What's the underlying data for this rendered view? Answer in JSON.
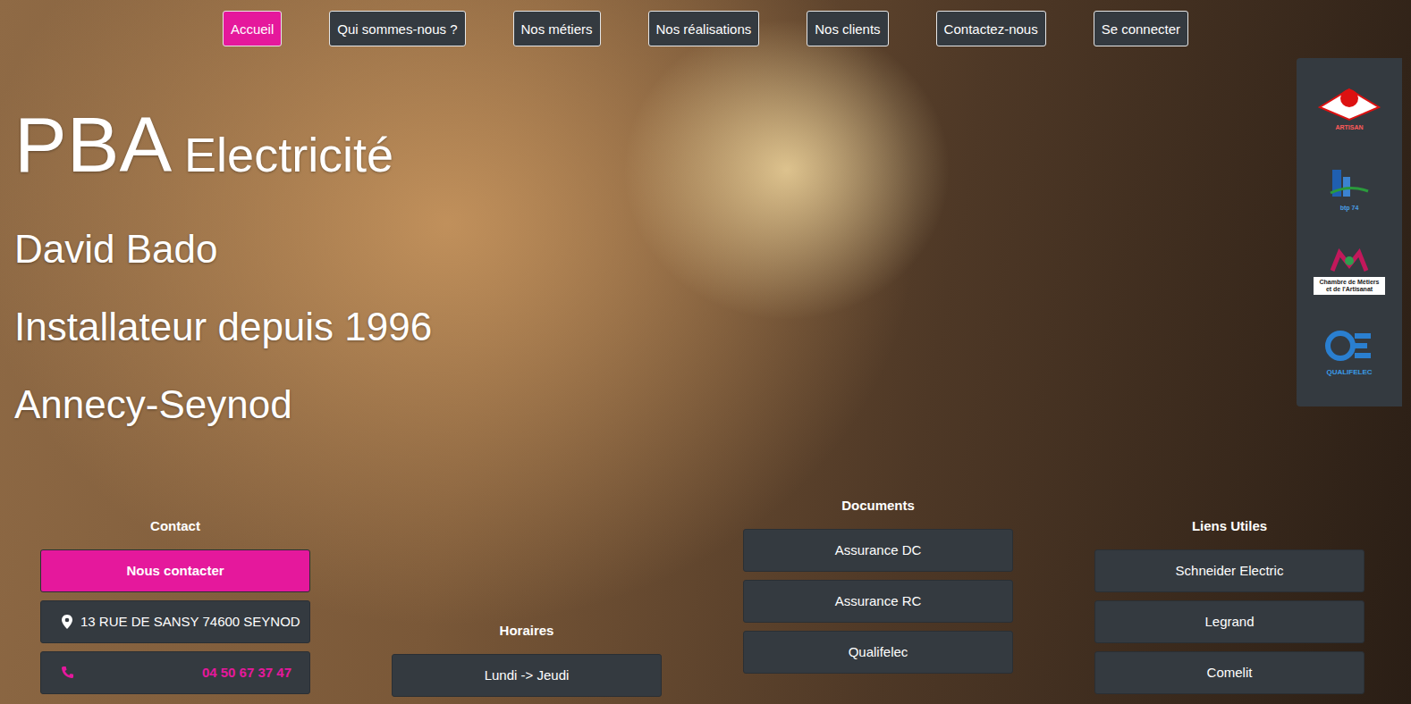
{
  "nav": [
    {
      "label": "Accueil",
      "selected": true
    },
    {
      "label": "Qui sommes-nous ?",
      "selected": false
    },
    {
      "label": "Nos métiers",
      "selected": false
    },
    {
      "label": "Nos réalisations",
      "selected": false
    },
    {
      "label": "Nos clients",
      "selected": false
    },
    {
      "label": "Contactez-nous",
      "selected": false
    },
    {
      "label": "Se connecter",
      "selected": false
    }
  ],
  "hero": {
    "brand": "PBA",
    "title": "Electricité",
    "lines": [
      "David Bado",
      "Installateur depuis 1996",
      "Annecy-Seynod"
    ]
  },
  "logos": [
    {
      "kind": "artisan",
      "caption": "ARTISAN"
    },
    {
      "kind": "btp",
      "caption": "btp 74"
    },
    {
      "kind": "cma",
      "caption": "Chambre de Métiers et de l'Artisanat"
    },
    {
      "kind": "qualifelec",
      "caption": "QUALIFELEC"
    }
  ],
  "contact": {
    "heading": "Contact",
    "button": "Nous contacter",
    "address": "13 RUE DE SANSY 74600 SEYNOD",
    "phone": "04 50 67 37 47"
  },
  "hours": {
    "heading": "Horaires",
    "rows": [
      "Lundi -> Jeudi"
    ]
  },
  "documents": {
    "heading": "Documents",
    "items": [
      "Assurance DC",
      "Assurance RC",
      "Qualifelec"
    ]
  },
  "links": {
    "heading": "Liens Utiles",
    "items": [
      "Schneider Electric",
      "Legrand",
      "Comelit"
    ]
  }
}
